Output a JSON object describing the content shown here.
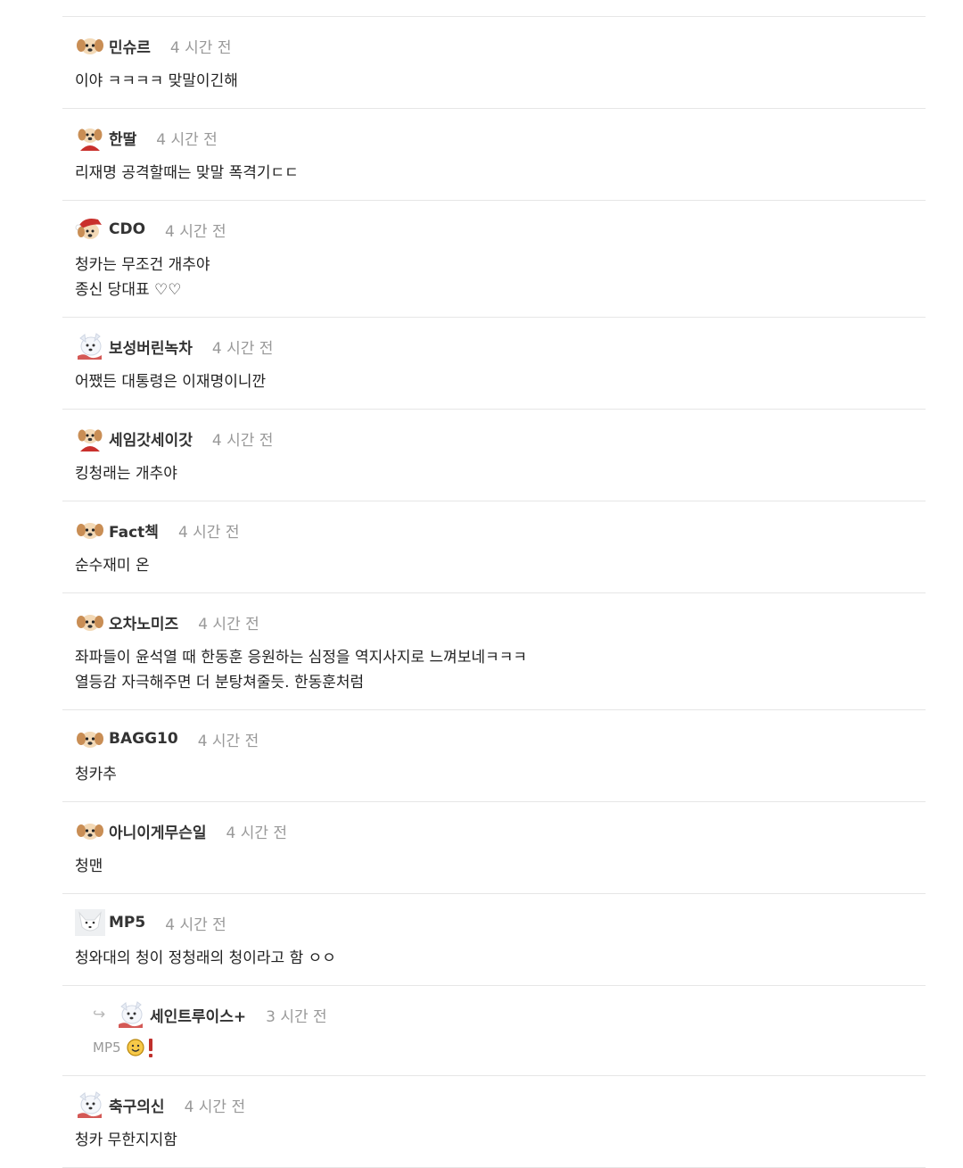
{
  "comments": [
    {
      "avatar": "puppy-icon",
      "nick": "민슈르",
      "time": "4 시간 전",
      "body": "이야 ㅋㅋㅋㅋ 맞말이긴해"
    },
    {
      "avatar": "puppy-red-icon",
      "nick": "한딸",
      "time": "4 시간 전",
      "body": "리재명 공격할때는 맞말 폭격기ㄷㄷ"
    },
    {
      "avatar": "santa-puppy-icon",
      "nick": "CDO",
      "time": "4 시간 전",
      "body": "청카는 무조건 개추야\n종신 당대표 ♡♡"
    },
    {
      "avatar": "white-dog-icon",
      "nick": "보성버린녹차",
      "time": "4 시간 전",
      "body": "어쨌든 대통령은 이재명이니깐"
    },
    {
      "avatar": "puppy-red-icon",
      "nick": "세임갓세이갓",
      "time": "4 시간 전",
      "body": "킹청래는 개추야"
    },
    {
      "avatar": "puppy-icon",
      "nick": "Fact첵",
      "time": "4 시간 전",
      "body": "순수재미 온"
    },
    {
      "avatar": "puppy-icon",
      "nick": "오차노미즈",
      "time": "4 시간 전",
      "body": "좌파들이 윤석열 때 한동훈 응원하는 심정을 역지사지로 느껴보네ㅋㅋㅋ\n열등감 자극해주면 더 분탕쳐줄듯. 한동훈처럼"
    },
    {
      "avatar": "puppy-icon",
      "nick": "BAGG10",
      "time": "4 시간 전",
      "body": "청카추"
    },
    {
      "avatar": "puppy-icon",
      "nick": "아니이게무슨일",
      "time": "4 시간 전",
      "body": "청맨"
    },
    {
      "avatar": "white-fox-icon",
      "nick": "MP5",
      "time": "4 시간 전",
      "body": "청와대의 청이 정청래의 청이라고 함 ㅇㅇ"
    }
  ],
  "reply": {
    "arrow": "↪",
    "avatar": "white-dog-icon",
    "nick": "세인트루이스+",
    "time": "3 시간 전",
    "mention": "MP5",
    "emoji": "smile-exclaim-icon"
  },
  "last_comment": {
    "avatar": "white-dog-icon",
    "nick": "축구의신",
    "time": "4 시간 전",
    "body": "청카 무한지지함"
  }
}
